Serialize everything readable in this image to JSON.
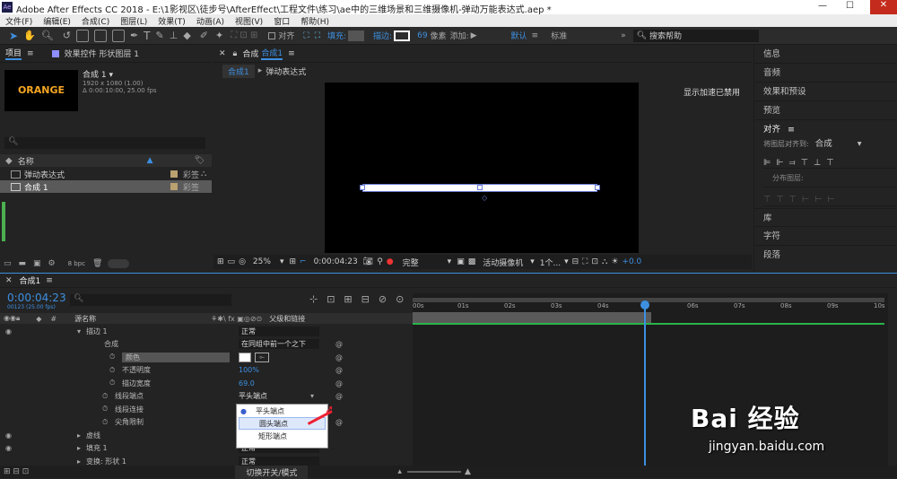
{
  "window": {
    "title": "Adobe After Effects CC 2018 - E:\\1影视区\\徒步号\\AfterEffect\\工程文件\\练习\\ae中的三维场景和三维摄像机-弹动万能表达式.aep *"
  },
  "menu": [
    "文件(F)",
    "编辑(E)",
    "合成(C)",
    "图层(L)",
    "效果(T)",
    "动画(A)",
    "视图(V)",
    "窗口",
    "帮助(H)"
  ],
  "toolbar": {
    "align": "对齐",
    "fill": "填充:",
    "stroke": "描边:",
    "stroke_width": "69",
    "unit": "像素",
    "add": "添加:",
    "workspace": "默认",
    "standard": "标准",
    "search": "搜索帮助"
  },
  "project": {
    "tab": "项目",
    "effects_tab": "效果控件 形状图层 1",
    "preview_text": "ORANGE",
    "comp_name": "合成 1",
    "comp_size": "1920 x 1080 (1.00)",
    "comp_dur": "Δ 0:00:10:00, 25.00 fps",
    "col_name": "名称",
    "items": [
      {
        "name": "弹动表达式",
        "tag": "彩签"
      },
      {
        "name": "合成 1",
        "tag": "彩签"
      }
    ],
    "bpc": "8 bpc"
  },
  "viewer": {
    "tab": "合成",
    "tab_name": "合成1",
    "sub1": "合成1",
    "sub2": "弹动表达式",
    "gpu": "显示加速已禁用",
    "zoom": "25%",
    "time": "0:00:04:23",
    "quality": "完整",
    "camera": "活动摄像机",
    "views": "1个...",
    "exposure": "+0.0"
  },
  "right": {
    "items": [
      "信息",
      "音频",
      "效果和预设",
      "预览",
      "对齐",
      "库",
      "字符",
      "段落"
    ],
    "align_to_label": "将图层对齐到:",
    "align_to": "合成",
    "distribute": "分布图层:"
  },
  "timeline": {
    "tab": "合成1",
    "time": "0:00:04:23",
    "frames": "00123 (25.00 fps)",
    "col_source": "源名称",
    "col_parent": "父级和链接",
    "switch": "切换开关/模式",
    "rulers": [
      "00s",
      "01s",
      "02s",
      "03s",
      "04s",
      "06s",
      "07s",
      "08s",
      "09s",
      "10s"
    ],
    "rows": [
      {
        "label": "描边 1",
        "value": "正常"
      },
      {
        "label": "合成",
        "value": "在同组中前一个之下"
      },
      {
        "label": "颜色",
        "value": ""
      },
      {
        "label": "不透明度",
        "value": "100%"
      },
      {
        "label": "描边宽度",
        "value": "69.0"
      },
      {
        "label": "线段端点",
        "value": "平头端点"
      },
      {
        "label": "线段连接",
        "value": ""
      },
      {
        "label": "尖角限制",
        "value": ""
      },
      {
        "label": "虚线",
        "value": ""
      },
      {
        "label": "填充 1",
        "value": "正常"
      },
      {
        "label": "变换: 形状 1",
        "value": "正常"
      }
    ]
  },
  "dropdown": [
    "平头端点",
    "圆头端点",
    "矩形端点"
  ],
  "watermark": {
    "text": "Bai 经验",
    "url": "jingyan.baidu.com"
  }
}
